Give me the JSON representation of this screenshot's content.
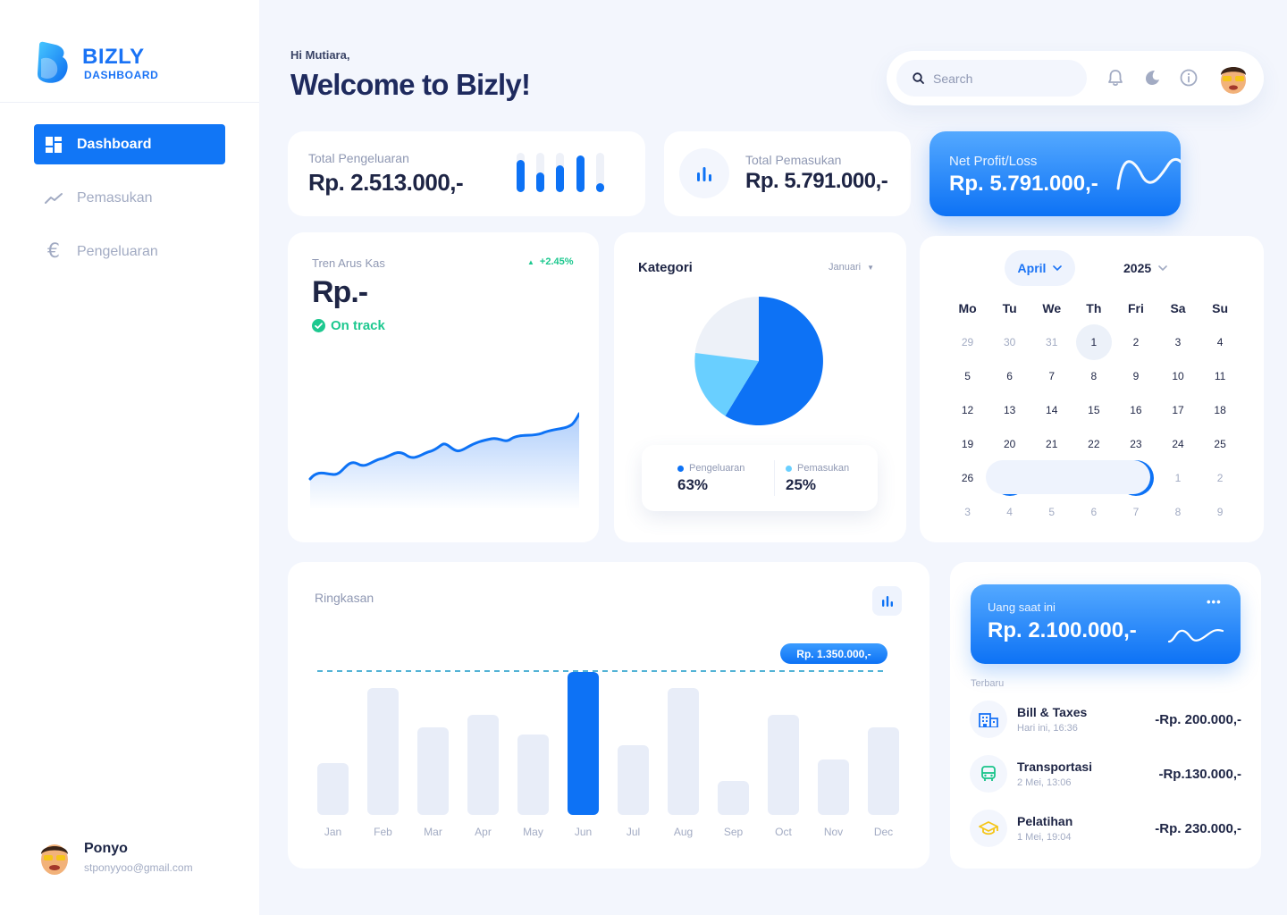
{
  "brand": {
    "name": "BIZLY",
    "sub": "DASHBOARD"
  },
  "nav": [
    {
      "label": "Dashboard",
      "icon": "dashboard-icon",
      "active": true
    },
    {
      "label": "Pemasukan",
      "icon": "trend-icon",
      "active": false
    },
    {
      "label": "Pengeluaran",
      "icon": "euro-icon",
      "active": false
    }
  ],
  "profile": {
    "name": "Ponyo",
    "email": "stponyyoo@gmail.com"
  },
  "header": {
    "greeting": "Hi Mutiara,",
    "title": "Welcome to Bizly!"
  },
  "search": {
    "placeholder": "Search"
  },
  "topbar_icons": [
    "bell-icon",
    "moon-icon",
    "info-icon",
    "avatar"
  ],
  "stats": {
    "pengeluaran": {
      "label": "Total Pengeluaran",
      "value": "Rp. 2.513.000,-"
    },
    "pemasukan": {
      "label": "Total Pemasukan",
      "value": "Rp. 5.791.000,-"
    },
    "net": {
      "label": "Net Profit/Loss",
      "value": "Rp. 5.791.000,-"
    }
  },
  "trend": {
    "label": "Tren Arus Kas",
    "change": "+2.45%",
    "value": "Rp.-",
    "status": "On track"
  },
  "kategori": {
    "title": "Kategori",
    "period": "Januari",
    "legend": [
      {
        "name": "Pengeluaran",
        "percent": "63%",
        "color": "#0d72f5"
      },
      {
        "name": "Pemasukan",
        "percent": "25%",
        "color": "#69cfff"
      }
    ]
  },
  "calendar": {
    "month": "April",
    "year": "2025",
    "days": [
      "Mo",
      "Tu",
      "We",
      "Th",
      "Fri",
      "Sa",
      "Su"
    ],
    "weeks": [
      [
        "29",
        "30",
        "31",
        "1",
        "2",
        "3",
        "4"
      ],
      [
        "5",
        "6",
        "7",
        "8",
        "9",
        "10",
        "11"
      ],
      [
        "12",
        "13",
        "14",
        "15",
        "16",
        "17",
        "18"
      ],
      [
        "19",
        "20",
        "21",
        "22",
        "23",
        "24",
        "25"
      ],
      [
        "26",
        "27",
        "28",
        "29",
        "30",
        "1",
        "2"
      ],
      [
        "3",
        "4",
        "5",
        "6",
        "7",
        "8",
        "9"
      ]
    ]
  },
  "ringkasan": {
    "title": "Ringkasan",
    "highlight_value": "Rp. 1.350.000,-"
  },
  "chart_data": {
    "type": "bar",
    "title": "Ringkasan",
    "categories": [
      "Jan",
      "Feb",
      "Mar",
      "Apr",
      "May",
      "Jun",
      "Jul",
      "Aug",
      "Sep",
      "Oct",
      "Nov",
      "Dec"
    ],
    "values": [
      58,
      142,
      98,
      112,
      90,
      160,
      78,
      142,
      38,
      112,
      62,
      98
    ],
    "highlight_index": 5,
    "ylim": [
      0,
      160
    ]
  },
  "wallet": {
    "label": "Uang saat ini",
    "value": "Rp. 2.100.000,-",
    "more": "•••"
  },
  "recent": {
    "label": "Terbaru",
    "items": [
      {
        "title": "Bill & Taxes",
        "time": "Hari ini, 16:36",
        "amount": "-Rp. 200.000,-",
        "icon": "building-icon",
        "color": "#1a73f5"
      },
      {
        "title": "Transportasi",
        "time": "2 Mei, 13:06",
        "amount": "-Rp.130.000,-",
        "icon": "bus-icon",
        "color": "#19c48a"
      },
      {
        "title": "Pelatihan",
        "time": "1 Mei, 19:04",
        "amount": "-Rp. 230.000,-",
        "icon": "graduation-cap-icon",
        "color": "#f5c518"
      }
    ]
  }
}
